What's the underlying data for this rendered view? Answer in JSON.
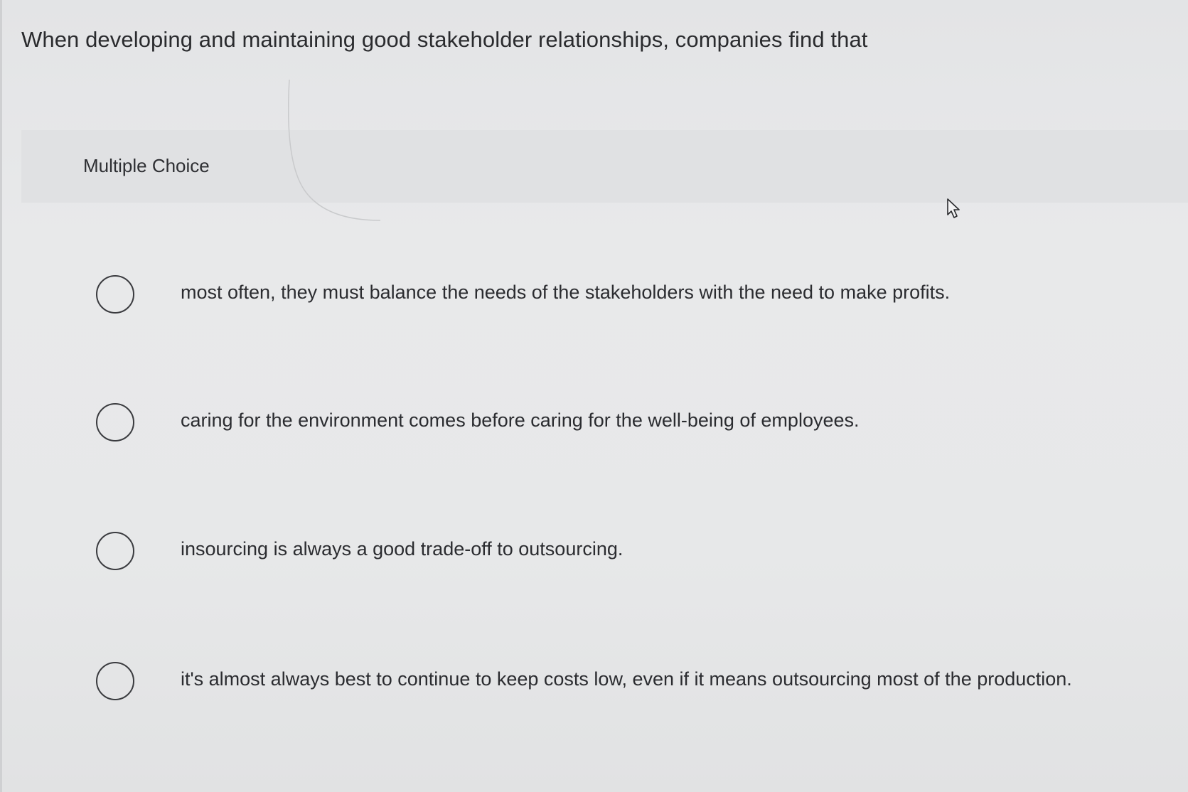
{
  "question": {
    "text": "When developing and maintaining good stakeholder relationships, companies find that"
  },
  "section": {
    "label": "Multiple Choice"
  },
  "options": [
    {
      "label": "most often, they must balance the needs of the stakeholders with the need to make profits."
    },
    {
      "label": "caring for the environment comes before caring for the well-being of employees."
    },
    {
      "label": "insourcing is always a good trade-off to outsourcing."
    },
    {
      "label": "it's almost always best to continue to keep costs low, even if it means outsourcing most of the production."
    }
  ],
  "icons": {
    "cursor": "mouse-pointer-icon"
  },
  "colors": {
    "background": "#e6e7e8",
    "text": "#2c2d30",
    "radio_border": "#3a3b3f"
  }
}
